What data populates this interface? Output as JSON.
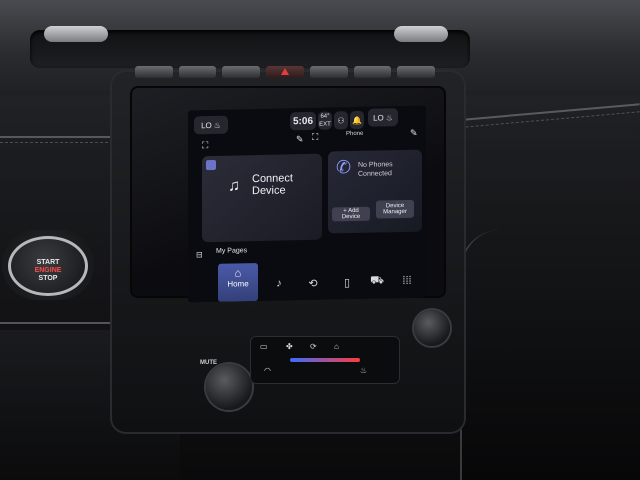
{
  "car_badge": {
    "line1": "START",
    "line2": "ENGINE",
    "line3": "STOP"
  },
  "status_bar": {
    "left_pill": "LO",
    "clock": "5:06",
    "temp_value": "64°",
    "temp_label": "EXT",
    "right_pill": "LO"
  },
  "connect_card": {
    "title_line1": "Connect",
    "title_line2": "Device"
  },
  "phone_card": {
    "header": "Phone",
    "status_line1": "No Phones",
    "status_line2": "Connected",
    "add_device": "+ Add Device",
    "device_manager_line1": "Device",
    "device_manager_line2": "Manager"
  },
  "nav": {
    "my_pages": "My Pages",
    "home": "Home"
  },
  "climate": {
    "mute_label": "MUTE"
  },
  "colors": {
    "accent": "#4a5aa8",
    "hazard": "#e0413a"
  }
}
